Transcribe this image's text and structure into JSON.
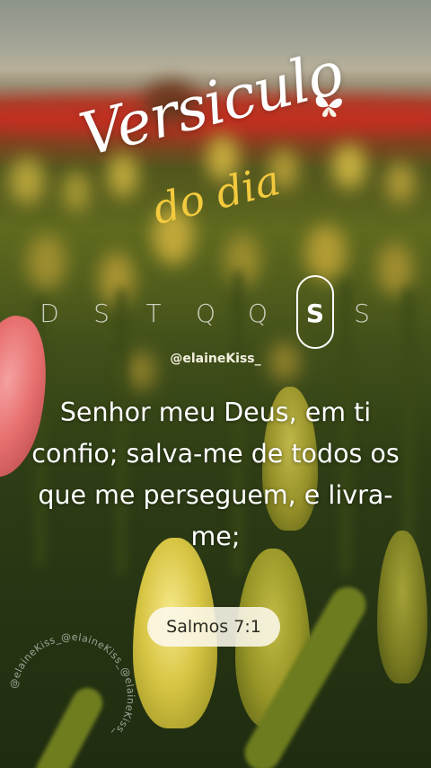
{
  "title": {
    "line1": "Versiculo",
    "line2": "do dia"
  },
  "days": {
    "letters": [
      "D",
      "S",
      "T",
      "Q",
      "Q",
      "S",
      "S"
    ],
    "active_index": 5
  },
  "handle": "@elaineKiss_",
  "verse": {
    "text": "Senhor meu Deus, em ti confio; salva-me de todos os que me perseguem, e livra-me;",
    "reference": "Salmos 7:1"
  },
  "watermark": "@elaineKiss_@elaineKiss_@elaineKiss_",
  "colors": {
    "title_primary": "#ffffff",
    "title_accent": "#f3ca3e",
    "pill_background": "#fcf8ec",
    "verse_text": "#ffffff"
  },
  "icons": [
    "butterfly-icon"
  ]
}
